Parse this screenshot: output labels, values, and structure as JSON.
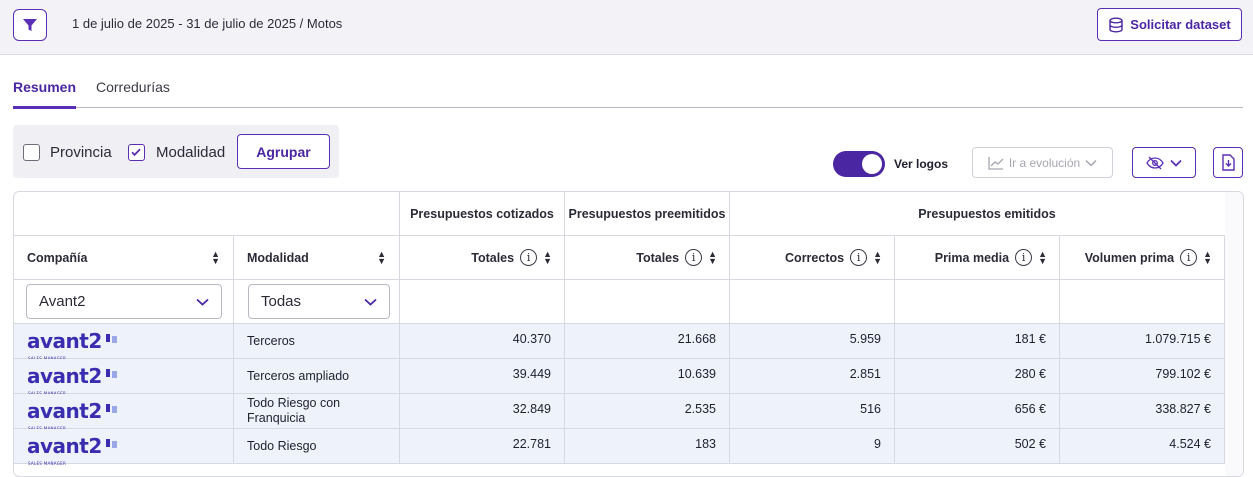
{
  "header": {
    "filter_summary": "1 de julio de 2025 - 31 de julio de 2025 / Motos",
    "dataset_button": "Solicitar dataset"
  },
  "tabs": [
    {
      "label": "Resumen",
      "active": true
    },
    {
      "label": "Corredurías",
      "active": false
    }
  ],
  "grouping": {
    "provincia": {
      "label": "Provincia",
      "checked": false
    },
    "modalidad": {
      "label": "Modalidad",
      "checked": true
    },
    "button": "Agrupar"
  },
  "toolbar": {
    "ver_logos": "Ver logos",
    "ver_logos_on": true,
    "evolution": "Ir a evolución"
  },
  "table": {
    "groups": {
      "cotizados": "Presupuestos cotizados",
      "preemitidos": "Presupuestos preemitidos",
      "emitidos": "Presupuestos emitidos"
    },
    "columns": {
      "compania": "Compañía",
      "modalidad": "Modalidad",
      "totales_cot": "Totales",
      "totales_pre": "Totales",
      "correctos": "Correctos",
      "prima_media": "Prima media",
      "volumen_prima": "Volumen prima"
    },
    "filters": {
      "compania": "Avant2",
      "modalidad": "Todas"
    },
    "logo_text": "avant2",
    "logo_sub": "SALES MANAGER",
    "rows": [
      {
        "modalidad": "Terceros",
        "cotizados": "40.370",
        "preemitidos": "21.668",
        "correctos": "5.959",
        "prima_media": "181 €",
        "volumen": "1.079.715 €"
      },
      {
        "modalidad": "Terceros ampliado",
        "cotizados": "39.449",
        "preemitidos": "10.639",
        "correctos": "2.851",
        "prima_media": "280 €",
        "volumen": "799.102 €"
      },
      {
        "modalidad": "Todo Riesgo con Franquicia",
        "cotizados": "32.849",
        "preemitidos": "2.535",
        "correctos": "516",
        "prima_media": "656 €",
        "volumen": "338.827 €"
      },
      {
        "modalidad": "Todo Riesgo",
        "cotizados": "22.781",
        "preemitidos": "183",
        "correctos": "9",
        "prima_media": "502 €",
        "volumen": "4.524 €"
      }
    ]
  },
  "colors": {
    "accent": "#5b2fb5",
    "row_bg": "#eef3fb",
    "logo": "#3a2db0"
  }
}
